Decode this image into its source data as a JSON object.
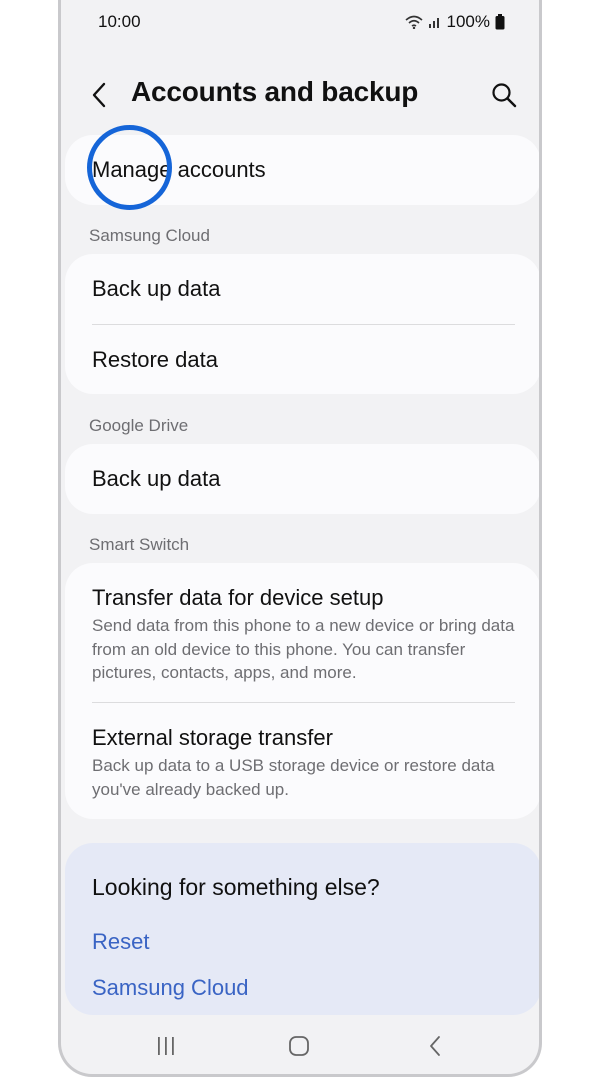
{
  "status": {
    "time": "10:00",
    "battery": "100%",
    "icons": [
      "wifi-icon",
      "signal-icon",
      "battery-icon"
    ]
  },
  "header": {
    "title": "Accounts and backup",
    "back_icon": "chevron-left-icon",
    "search_icon": "search-icon"
  },
  "manage_accounts": {
    "label": "Manage accounts"
  },
  "sections": {
    "samsung_cloud": {
      "label": "Samsung Cloud",
      "items": [
        {
          "title": "Back up data"
        },
        {
          "title": "Restore data"
        }
      ]
    },
    "google_drive": {
      "label": "Google Drive",
      "items": [
        {
          "title": "Back up data"
        }
      ]
    },
    "smart_switch": {
      "label": "Smart Switch",
      "items": [
        {
          "title": "Transfer data for device setup",
          "description": "Send data from this phone to a new device or bring data from an old device to this phone. You can transfer pictures, contacts, apps, and more."
        },
        {
          "title": "External storage transfer",
          "description": "Back up data to a USB storage device or restore data you've already backed up."
        }
      ]
    }
  },
  "looking_for": {
    "title": "Looking for something else?",
    "links": [
      "Reset",
      "Samsung Cloud"
    ]
  },
  "nav": {
    "icons": [
      "recents-icon",
      "home-icon",
      "back-icon"
    ]
  },
  "colors": {
    "highlight": "#1565d8",
    "link": "#3a64c4",
    "background": "#f2f2f4",
    "card": "#fbfbfd",
    "suggestion_card": "#e5e9f6"
  }
}
